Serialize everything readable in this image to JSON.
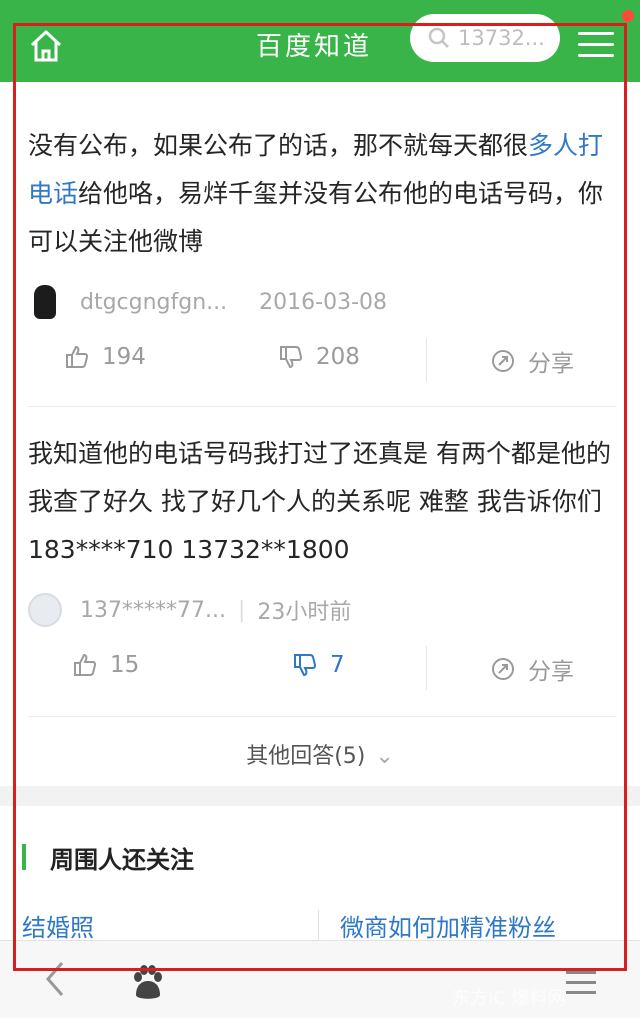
{
  "header": {
    "title": "百度知道",
    "search_text": "13732...",
    "icons": [
      "home-icon",
      "search-icon",
      "menu-icon"
    ],
    "accent": "#38b449"
  },
  "answers": [
    {
      "text_before": "没有公布，如果公布了的话，那不就每天都很",
      "link_text": "多人打电话",
      "text_after": "给他咯，易烊千玺并没有公布他的电话号码，你可以关注他微博",
      "author": "dtgcgngfgn...",
      "date": "2016-03-08",
      "likes": "194",
      "dislikes": "208",
      "share": "分享"
    },
    {
      "text": "我知道他的电话号码我打过了还真是 有两个都是他的 我查了好久 找了好几个人的关系呢 难整 我告诉你们 183****710 13732**1800",
      "author": "137*****77...",
      "date": "23小时前",
      "likes": "15",
      "dislikes": "7",
      "share": "分享"
    }
  ],
  "more_answers": "其他回答(5)",
  "related": {
    "title": "周围人还关注",
    "items": [
      "结婚照",
      "微商如何加精准粉丝"
    ]
  },
  "watermark": "东方IC 爆料网",
  "colors": {
    "link": "#2f78c8",
    "frame": "#d81e1e"
  }
}
